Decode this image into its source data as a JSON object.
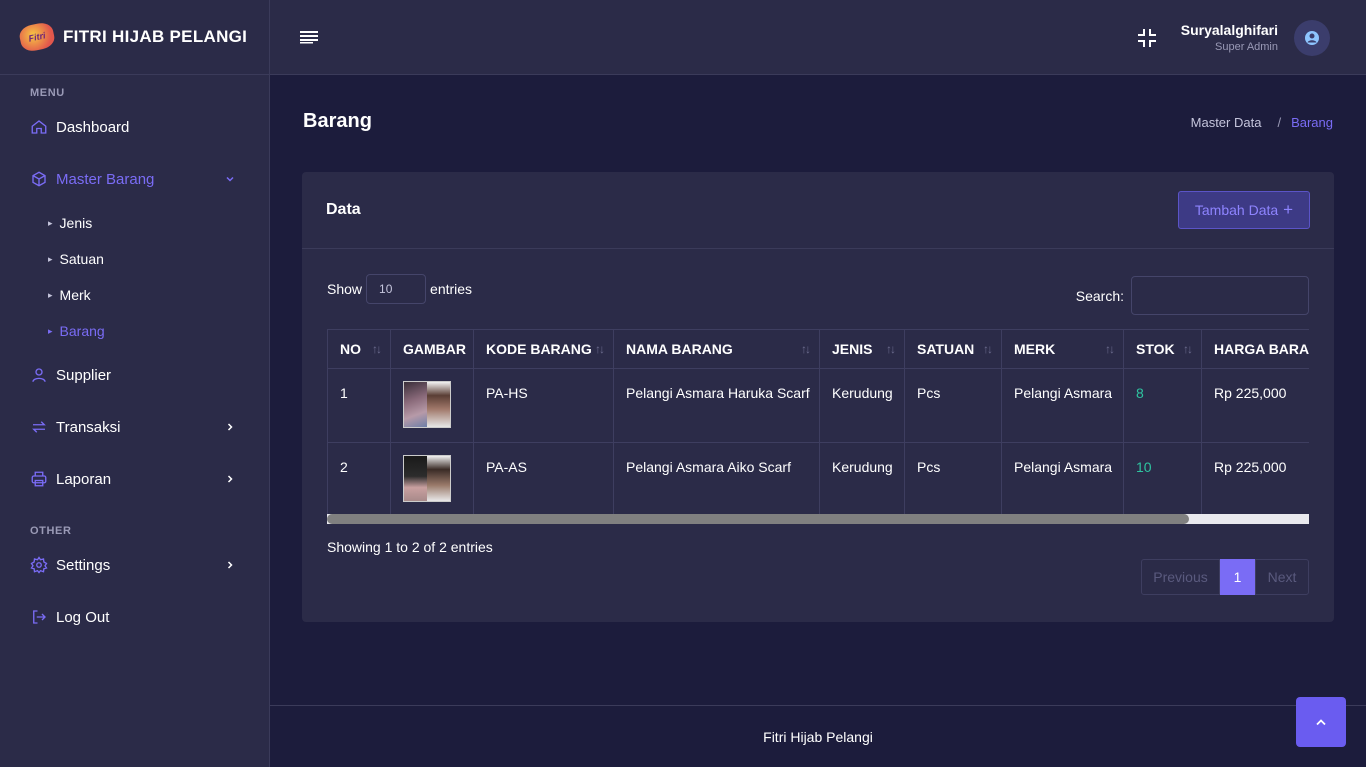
{
  "brand": {
    "logo_text": "Fitri",
    "name": "FITRI HIJAB PELANGI"
  },
  "sidebar": {
    "menu_heading": "MENU",
    "other_heading": "OTHER",
    "items": {
      "dashboard": "Dashboard",
      "master_barang": "Master Barang",
      "supplier": "Supplier",
      "transaksi": "Transaksi",
      "laporan": "Laporan",
      "settings": "Settings",
      "logout": "Log Out"
    },
    "sub_items": [
      "Jenis",
      "Satuan",
      "Merk",
      "Barang"
    ]
  },
  "header": {
    "user_name": "Suryalalghifari",
    "user_role": "Super Admin"
  },
  "page": {
    "title": "Barang",
    "breadcrumb": [
      "Master Data",
      "/",
      "Barang"
    ]
  },
  "card": {
    "title": "Data",
    "add_button": "Tambah Data",
    "add_icon": "+",
    "show_label": "Show",
    "entries_value": "10",
    "entries_label": "entries",
    "search_label": "Search:",
    "search_value": ""
  },
  "table": {
    "headers": [
      "NO",
      "GAMBAR",
      "KODE BARANG",
      "NAMA BARANG",
      "JENIS",
      "SATUAN",
      "MERK",
      "STOK",
      "HARGA BARANG"
    ],
    "rows": [
      {
        "no": "1",
        "kode": "PA-HS",
        "nama": "Pelangi Asmara Haruka Scarf",
        "jenis": "Kerudung",
        "satuan": "Pcs",
        "merk": "Pelangi Asmara",
        "stok": "8",
        "harga": "Rp 225,000"
      },
      {
        "no": "2",
        "kode": "PA-AS",
        "nama": "Pelangi Asmara Aiko Scarf",
        "jenis": "Kerudung",
        "satuan": "Pcs",
        "merk": "Pelangi Asmara",
        "stok": "10",
        "harga": "Rp 225,000"
      }
    ],
    "sort_icon": "↑↓"
  },
  "pagination": {
    "info": "Showing 1 to 2 of 2 entries",
    "previous": "Previous",
    "current": "1",
    "next": "Next"
  },
  "footer": {
    "text": "Fitri Hijab Pelangi"
  },
  "colors": {
    "accent": "#7a6cf5",
    "stock": "#2ec4a0",
    "panel": "#2b2b48",
    "background": "#1c1c3c"
  }
}
